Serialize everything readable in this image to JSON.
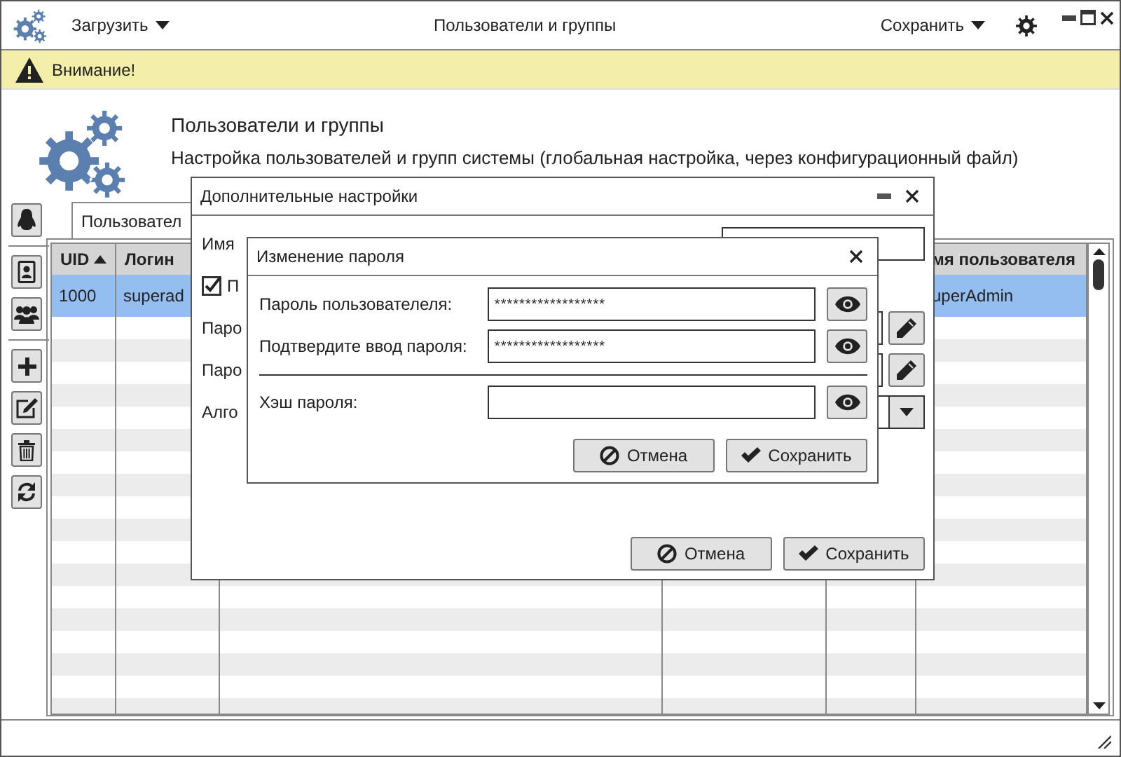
{
  "window": {
    "title": "Пользователи и группы",
    "load_menu": "Загрузить",
    "save_menu": "Сохранить"
  },
  "warning": "Внимание!",
  "header": {
    "title": "Пользователи и группы",
    "subtitle": "Настройка пользователей и групп системы (глобальная настройка, через конфигурационный файл)"
  },
  "tabs": [
    {
      "label": "Пользовател",
      "selected": true
    }
  ],
  "table": {
    "columns": [
      {
        "label": "UID",
        "sorted": true
      },
      {
        "label": "Логин",
        "sorted": false
      },
      {
        "label": "мя пользователя",
        "sorted": false
      }
    ],
    "rows": [
      {
        "cells": [
          "1000",
          "superad",
          "uperAdmin"
        ],
        "selected": true
      }
    ]
  },
  "settings_dialog": {
    "title": "Дополнительные настройки",
    "fields": [
      {
        "label": "Имя",
        "kind": "text"
      },
      {
        "label": "П",
        "kind": "checkbox",
        "checked": true
      },
      {
        "label": "Паро",
        "kind": "password"
      },
      {
        "label": "Паро",
        "kind": "password"
      },
      {
        "label": "Алго",
        "kind": "select"
      }
    ],
    "buttons": [
      {
        "label": "Отмена",
        "kind": "cancel"
      },
      {
        "label": "Сохранить",
        "kind": "save"
      }
    ]
  },
  "password_dialog": {
    "title": "Изменение пароля",
    "fields": [
      {
        "label": "Пароль пользователеля:",
        "kind": "password",
        "value": "******************"
      },
      {
        "label": "Подтвердите ввод пароля:",
        "kind": "password",
        "value": "******************"
      },
      {
        "label": "Хэш пароля:",
        "kind": "hash"
      }
    ],
    "buttons": [
      {
        "label": "Отмена",
        "kind": "cancel"
      },
      {
        "label": "Сохранить",
        "kind": "save"
      }
    ]
  }
}
